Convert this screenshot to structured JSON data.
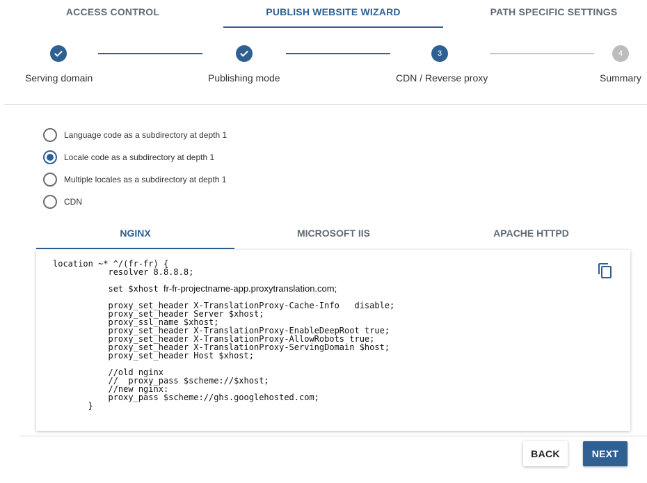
{
  "top_tabs": [
    {
      "label": "ACCESS CONTROL"
    },
    {
      "label": "PUBLISH WEBSITE WIZARD",
      "active": true
    },
    {
      "label": "PATH SPECIFIC SETTINGS"
    }
  ],
  "stepper": {
    "steps": [
      {
        "label": "Serving domain",
        "state": "completed"
      },
      {
        "label": "Publishing mode",
        "state": "completed"
      },
      {
        "label": "CDN / Reverse proxy",
        "state": "current",
        "number": "3"
      },
      {
        "label": "Summary",
        "state": "pending",
        "number": "4"
      }
    ]
  },
  "radio_options": [
    {
      "label": "Language code as a subdirectory at depth 1",
      "checked": false
    },
    {
      "label": "Locale code as a subdirectory at depth 1",
      "checked": true
    },
    {
      "label": "Multiple locales as a subdirectory at depth 1",
      "checked": false
    },
    {
      "label": "CDN",
      "checked": false
    }
  ],
  "code_tabs": [
    {
      "label": "NGINX",
      "active": true
    },
    {
      "label": "MICROSOFT IIS"
    },
    {
      "label": "APACHE HTTPD"
    }
  ],
  "code": {
    "line_1": "location ~* ^/(fr-fr) {",
    "line_2": "           resolver 8.8.8.8;",
    "line_3_prefix": "           set $xhost ",
    "line_3_host": "fr-fr-projectname-app.proxytranslation.com;",
    "line_4": "           proxy_set_header X-TranslationProxy-Cache-Info   disable;",
    "line_5": "           proxy_set_header Server $xhost;",
    "line_6": "           proxy_ssl_name $xhost;",
    "line_7": "           proxy_set_header X-TranslationProxy-EnableDeepRoot true;",
    "line_8": "           proxy_set_header X-TranslationProxy-AllowRobots true;",
    "line_9": "           proxy_set_header X-TranslationProxy-ServingDomain $host;",
    "line_10": "           proxy_set_header Host $xhost;",
    "line_11": "           //old nginx",
    "line_12": "           //  proxy_pass $scheme://$xhost;",
    "line_13": "           //new nginx:",
    "line_14": "           proxy_pass $scheme://ghs.googlehosted.com;",
    "line_15": "       }"
  },
  "buttons": {
    "back_label": "BACK",
    "next_label": "NEXT"
  },
  "colors": {
    "accent": "#2e6094",
    "inactive_step": "#bdbdbd"
  },
  "icons": {
    "check": "check-icon",
    "copy": "copy-icon"
  }
}
